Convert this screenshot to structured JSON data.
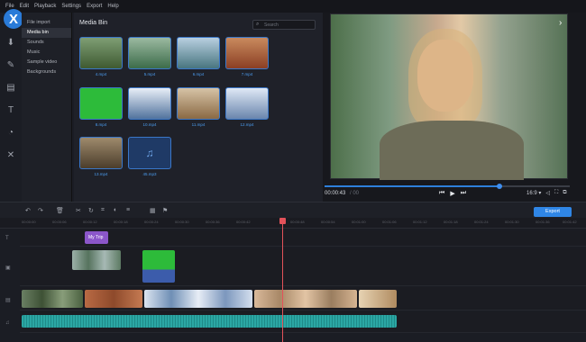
{
  "menu": [
    "File",
    "Edit",
    "Playback",
    "Settings",
    "Export",
    "Help"
  ],
  "logo": "X",
  "imports": [
    {
      "label": "File import",
      "active": false
    },
    {
      "label": "Media bin",
      "active": true
    },
    {
      "label": "Sounds",
      "active": false
    },
    {
      "label": "Music",
      "active": false
    },
    {
      "label": "Sample video",
      "active": false
    },
    {
      "label": "Backgrounds",
      "active": false
    }
  ],
  "bin": {
    "title": "Media Bin",
    "search_placeholder": "Search",
    "items": [
      {
        "label": "4.mp4",
        "color": "#4f6b3a"
      },
      {
        "label": "5.mp4",
        "color": "#5a7b59"
      },
      {
        "label": "6.mp4",
        "color": "#5b7f86"
      },
      {
        "label": "7.mp4",
        "color": "#a4593a"
      },
      {
        "label": "8.mp4",
        "color": "#2dbb3a"
      },
      {
        "label": "10.mp4",
        "color": "#6d8cb0"
      },
      {
        "label": "11.mp4",
        "color": "#b08b63"
      },
      {
        "label": "12.mp4",
        "color": "#8fa6c7"
      },
      {
        "label": "13.mp4",
        "color": "#7a6a52"
      },
      {
        "label": "45.mp3",
        "color": "#1f3a66"
      }
    ]
  },
  "player": {
    "time_current": "00:00:43",
    "time_total": "/ 00",
    "aspect": "16:9 ▾",
    "progress": 0.75
  },
  "export_label": "Export",
  "ruler_ticks": [
    "00:00:00",
    "00:00:06",
    "00:00:12",
    "00:00:18",
    "00:00:24",
    "00:00:30",
    "00:00:36",
    "00:00:42",
    "00:00:48",
    "00:00:54",
    "00:01:00",
    "00:01:06",
    "00:01:12",
    "00:01:18",
    "00:01:24",
    "00:01:30",
    "00:01:36",
    "00:01:42"
  ],
  "title_clip": "My Trip",
  "colors": {
    "accent": "#2f86e6",
    "playhead": "#e3525a",
    "audio": "#2ba7a4",
    "title": "#8b56c9"
  }
}
